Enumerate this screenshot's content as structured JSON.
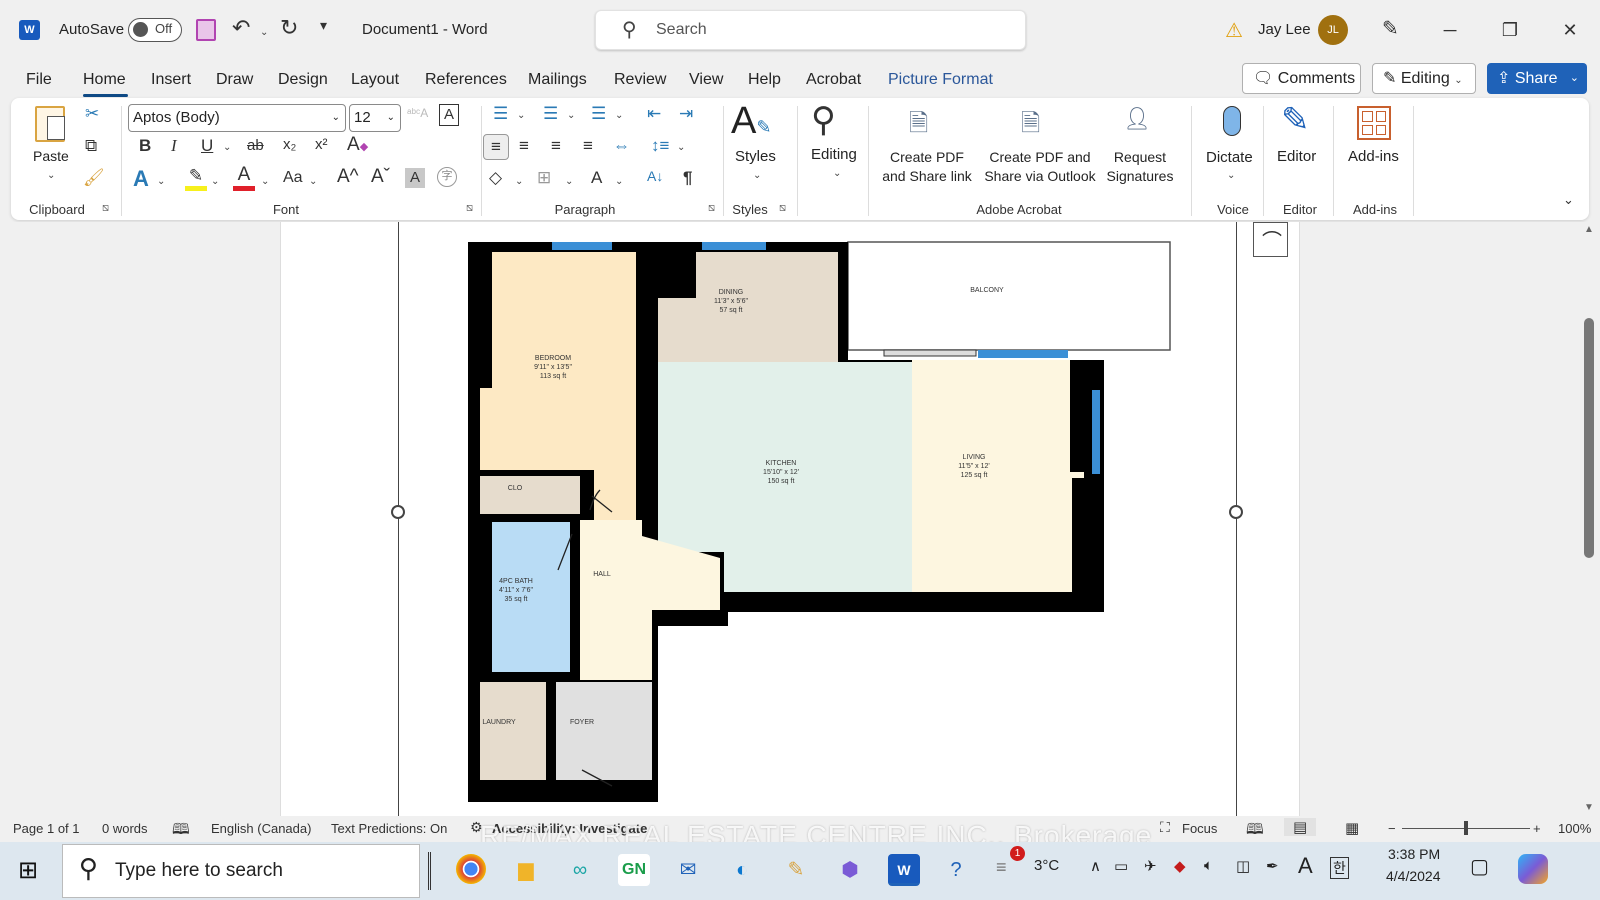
{
  "titlebar": {
    "app_icon": "word-icon",
    "autosave_label": "AutoSave",
    "autosave_state": "Off",
    "document_title": "Document1  -  Word",
    "search_placeholder": "Search",
    "user_name": "Jay Lee",
    "user_initials": "JL",
    "window_controls": [
      "minimize",
      "restore",
      "close"
    ]
  },
  "menu": {
    "tabs": [
      "File",
      "Home",
      "Insert",
      "Draw",
      "Design",
      "Layout",
      "References",
      "Mailings",
      "Review",
      "View",
      "Help",
      "Acrobat",
      "Picture Format"
    ],
    "active_tab": "Home",
    "contextual_tab_color": "#2b579a",
    "comments_label": "Comments",
    "editing_label": "Editing",
    "share_label": "Share",
    "share_color": "#1f62b8"
  },
  "ribbon": {
    "clipboard": {
      "label": "Clipboard",
      "paste": "Paste"
    },
    "font": {
      "label": "Font",
      "font_name": "Aptos (Body)",
      "font_size": "12",
      "bold": "B",
      "italic": "I",
      "underline": "U",
      "strike": "ab",
      "subscript": "x₂",
      "superscript": "x²",
      "case": "Aa",
      "grow": "A^",
      "shrink": "Aˇ"
    },
    "paragraph": {
      "label": "Paragraph"
    },
    "styles": {
      "label": "Styles",
      "button": "Styles"
    },
    "editing": {
      "button": "Editing"
    },
    "acrobat": {
      "label": "Adobe Acrobat",
      "btn1": [
        "Create PDF",
        "and Share link"
      ],
      "btn2": [
        "Create PDF and",
        "Share via Outlook"
      ],
      "btn3": [
        "Request",
        "Signatures"
      ]
    },
    "voice": {
      "label": "Voice",
      "button": "Dictate"
    },
    "editor": {
      "label": "Editor",
      "button": "Editor"
    },
    "addins": {
      "label": "Add-ins",
      "button": "Add-ins"
    }
  },
  "floorplan": {
    "rooms": [
      {
        "name": "BEDROOM",
        "dims": "9'11\" x 13'5\"",
        "area": "113 sq ft",
        "color": "#fde9c4"
      },
      {
        "name": "DINING",
        "dims": "11'3\" x 5'6\"",
        "area": "57 sq ft",
        "color": "#e6dccd"
      },
      {
        "name": "BALCONY",
        "dims": "",
        "area": "",
        "color": "#ffffff"
      },
      {
        "name": "KITCHEN",
        "dims": "15'10\" x 12'",
        "area": "150 sq ft",
        "color": "#e2f0ea"
      },
      {
        "name": "LIVING",
        "dims": "11'5\" x 12'",
        "area": "125 sq ft",
        "color": "#fdf6e0"
      },
      {
        "name": "CLO",
        "dims": "",
        "area": "",
        "color": "#e6dccd"
      },
      {
        "name": "4PC BATH",
        "dims": "4'11\" x 7'6\"",
        "area": "35 sq ft",
        "color": "#b9dcf5"
      },
      {
        "name": "HALL",
        "dims": "",
        "area": "",
        "color": "#fdf6e0"
      },
      {
        "name": "LAUNDRY",
        "dims": "",
        "area": "",
        "color": "#e6dccd"
      },
      {
        "name": "FOYER",
        "dims": "",
        "area": "",
        "color": "#e0e0e0"
      }
    ]
  },
  "statusbar": {
    "page": "Page 1 of 1",
    "words": "0 words",
    "language": "English (Canada)",
    "text_predictions": "Text Predictions: On",
    "accessibility": "Accessibility: Investigate",
    "focus": "Focus",
    "zoom": "100%",
    "zoom_percent": 100
  },
  "watermark": "RE/MAX REAL ESTATE CENTRE INC., Brokerage",
  "taskbar": {
    "search_placeholder": "Type here to search",
    "apps": [
      "chrome",
      "file-explorer",
      "copilot-link",
      "gn",
      "mail",
      "edge",
      "paint",
      "copilot",
      "word",
      "help"
    ],
    "weather_badge": "1",
    "temperature": "3°C",
    "time": "3:38 PM",
    "date": "4/4/2024",
    "ime": "한",
    "font_glyph": "A"
  }
}
